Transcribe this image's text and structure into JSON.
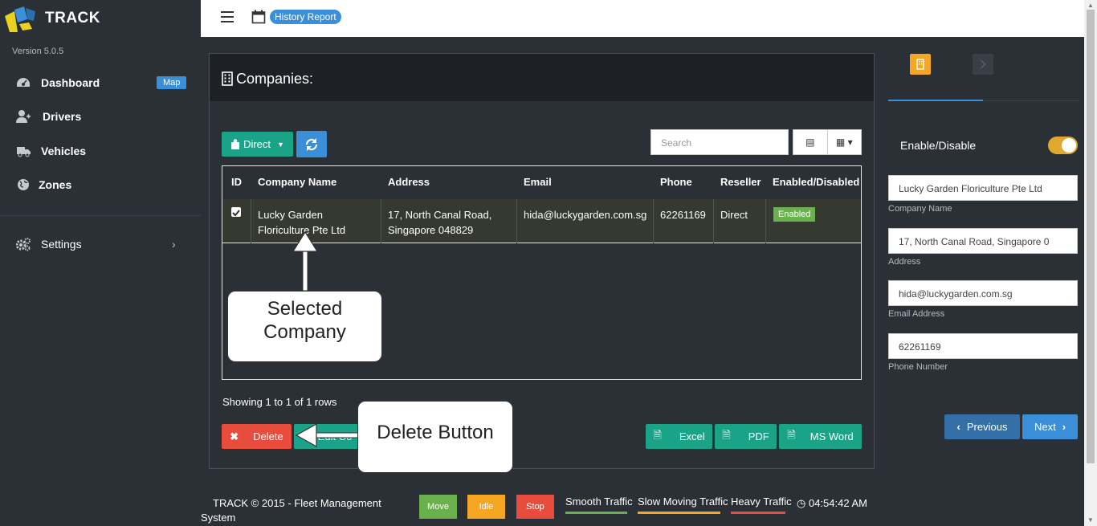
{
  "app": {
    "brand": "TRACK",
    "version": "Version 5.0.5"
  },
  "sidebar": {
    "items": [
      {
        "label": "Dashboard",
        "icon": "dashboard-icon"
      },
      {
        "label": "Drivers",
        "icon": "user-add-icon"
      },
      {
        "label": "Vehicles",
        "icon": "truck-icon"
      },
      {
        "label": "Zones",
        "icon": "globe-icon"
      },
      {
        "label": "Settings",
        "icon": "gears-icon"
      }
    ],
    "map_badge": "Map"
  },
  "topbar": {
    "report_label": "History Report"
  },
  "panel": {
    "title": "Companies:",
    "filter_label": "Direct",
    "search_placeholder": "Search",
    "columns": [
      "ID",
      "Company Name",
      "Address",
      "Email",
      "Phone",
      "Reseller",
      "Enabled/Disabled"
    ],
    "rows": [
      {
        "name_l1": "Lucky Garden",
        "name_l2": "Floriculture Pte Ltd",
        "addr_l1": "17, North Canal Road,",
        "addr_l2": "Singapore 048829",
        "email": "hida@luckygarden.com.sg",
        "phone": "62261169",
        "reseller": "Direct",
        "status": "Enabled"
      }
    ],
    "showing": "Showing 1 to 1 of 1 rows",
    "delete_label": "Delete",
    "edit_label": "Edit Co",
    "excel_label": "Excel",
    "pdf_label": "PDF",
    "word_label": "MS Word"
  },
  "callouts": {
    "selected_l1": "Selected",
    "selected_l2": "Company",
    "delete": "Delete Button"
  },
  "right": {
    "enable_label": "Enable/Disable",
    "fields": [
      {
        "value": "Lucky Garden Floriculture Pte Ltd",
        "label": "Company Name"
      },
      {
        "value": "17, North Canal Road, Singapore 0",
        "label": "Address"
      },
      {
        "value": "hida@luckygarden.com.sg",
        "label": "Email Address"
      },
      {
        "value": "62261169",
        "label": "Phone Number"
      }
    ],
    "prev_label": "Previous",
    "next_label": "Next"
  },
  "footer": {
    "copy": "TRACK © 2015 - Fleet Management System",
    "move": "Move",
    "idle": "Idle",
    "stop": "Stop",
    "smooth": "Smooth Traffic",
    "slow": "Slow Moving Traffic",
    "heavy": "Heavy Traffic",
    "time": "04:54:42 AM"
  },
  "colors": {
    "teal": "#1aa386",
    "blue": "#3b8ed8",
    "red": "#e74c3c",
    "orange": "#f5a623",
    "green": "#6ab04c"
  }
}
